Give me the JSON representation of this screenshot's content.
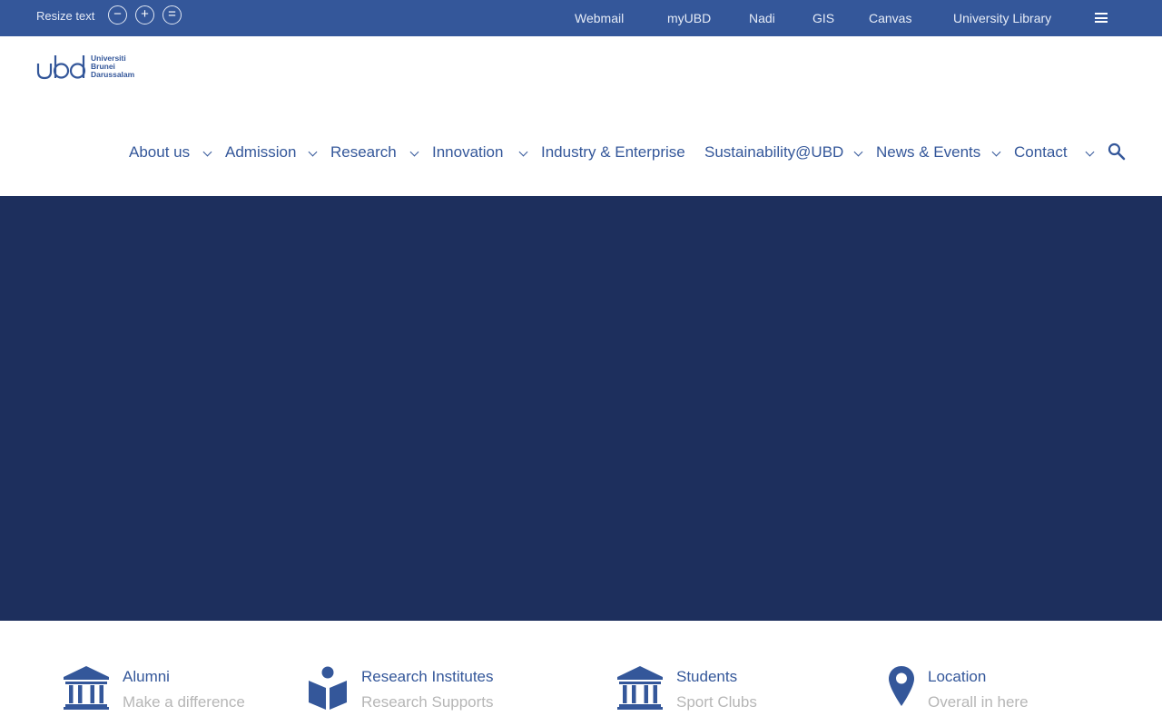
{
  "topbar": {
    "resize_label": "Resize text",
    "resize_controls": [
      "−",
      "+",
      "="
    ],
    "links": [
      "Webmail",
      "myUBD",
      "Nadi",
      "GIS",
      "Canvas",
      "University Library"
    ]
  },
  "logo": {
    "lines": [
      "Universiti",
      "Brunei",
      "Darussalam"
    ]
  },
  "nav": {
    "items": [
      "About us",
      "Admission",
      "Research",
      "Innovation",
      "Industry & Enterprise",
      "Sustainability@UBD",
      "News & Events",
      "Contact"
    ]
  },
  "quick_links": [
    {
      "title": "Alumni",
      "subtitle": "Make a difference",
      "icon": "institution-icon"
    },
    {
      "title": "Research Institutes",
      "subtitle": "Research Supports",
      "icon": "reading-icon"
    },
    {
      "title": "Students",
      "subtitle": "Sport Clubs",
      "icon": "institution-icon"
    },
    {
      "title": "Location",
      "subtitle": "Overall in here",
      "icon": "map-marker-icon"
    }
  ],
  "colors": {
    "brand_blue": "#34579a",
    "hero_navy": "#1d2f5d",
    "muted_text": "#b6b6b6"
  }
}
